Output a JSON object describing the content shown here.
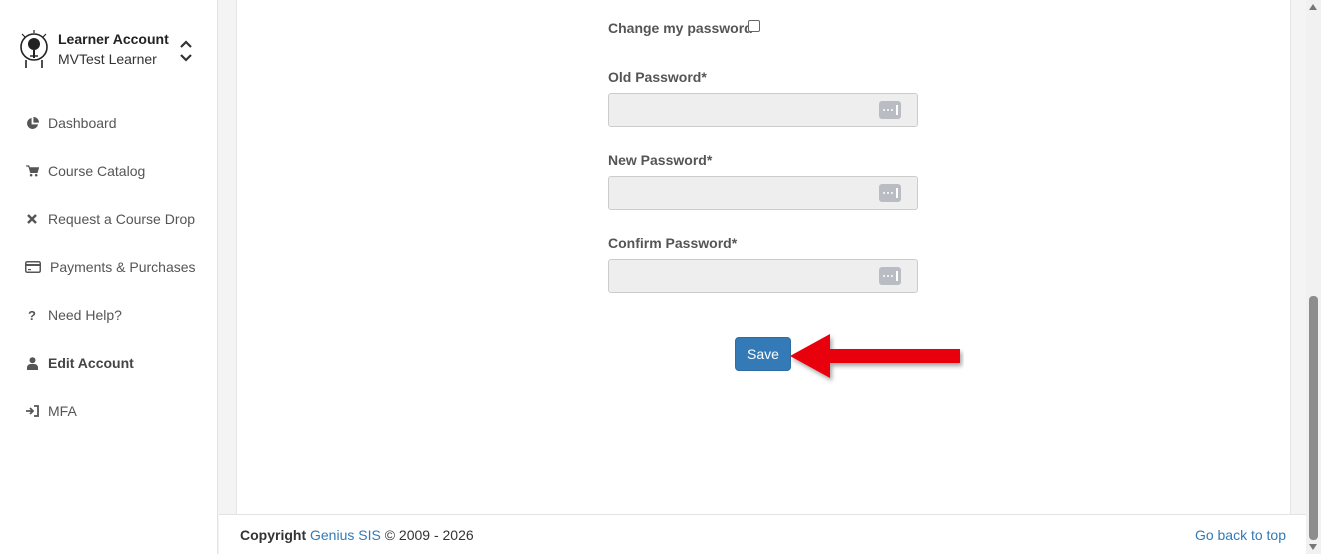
{
  "account": {
    "title": "Learner Account",
    "user": "MVTest Learner"
  },
  "sidebar": {
    "items": [
      {
        "label": "Dashboard",
        "icon": "pie-chart-icon"
      },
      {
        "label": "Course Catalog",
        "icon": "cart-icon"
      },
      {
        "label": "Request a Course Drop",
        "icon": "times-icon"
      },
      {
        "label": "Payments & Purchases",
        "icon": "credit-card-icon"
      },
      {
        "label": "Need Help?",
        "icon": "question-icon"
      },
      {
        "label": "Edit Account",
        "icon": "user-icon",
        "active": true
      },
      {
        "label": "MFA",
        "icon": "sign-in-icon"
      }
    ]
  },
  "form": {
    "change_password_label": "Change my password",
    "change_password_checked": false,
    "old_password_label": "Old Password*",
    "new_password_label": "New Password*",
    "confirm_password_label": "Confirm Password*",
    "save_label": "Save"
  },
  "footer": {
    "copyright_label": "Copyright",
    "company": "Genius SIS",
    "years": "© 2009 - 2026",
    "back_to_top": "Go back to top"
  },
  "colors": {
    "primary": "#337ab7",
    "arrow": "#e8000b"
  }
}
